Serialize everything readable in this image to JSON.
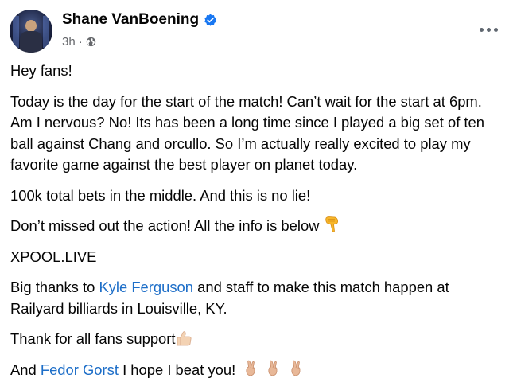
{
  "post": {
    "author": "Shane VanBoening",
    "time": "3h",
    "verified_icon": "verified-badge-icon",
    "audience_icon": "globe-icon",
    "more_icon": "more-options-icon",
    "paragraphs": {
      "p1": "Hey fans!",
      "p2": "Today is the day for the start of the match! Can’t wait for the start at 6pm. Am I nervous? No! Its has been a long time since I played a big set of ten ball against Chang and orcullo. So I’m actually really excited to play my favorite game against the best player on planet today.",
      "p3": "100k total bets in the middle. And this is no lie!",
      "p4": "Don’t missed out the action! All the info is below",
      "p5": "XPOOL.LIVE",
      "p6_before": "Big thanks to ",
      "p6_link": "Kyle Ferguson",
      "p6_after": " and staff to make this match happen at Railyard billiards in Louisville, KY.",
      "p7": "Thank for all fans support",
      "p8_before": "And ",
      "p8_link": "Fedor Gorst",
      "p8_after": " I hope I beat you!"
    },
    "emojis": {
      "pointing_down": "backhand-index-pointing-down-emoji",
      "thumbs_up": "thumbs-up-emoji",
      "crossed_fingers": "crossed-fingers-emoji"
    },
    "colors": {
      "link": "#1d6ec8",
      "verified": "#1877f2",
      "meta": "#65676b"
    }
  }
}
